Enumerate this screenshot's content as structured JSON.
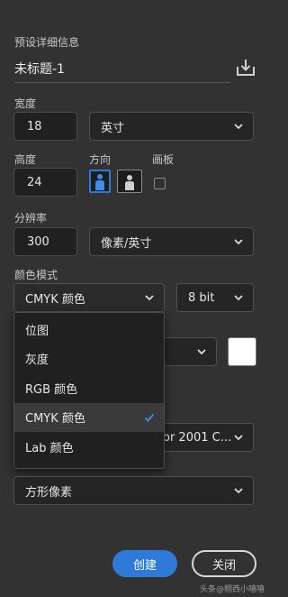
{
  "panel": {
    "title": "预设详细信息",
    "doc_name": "未标题-1",
    "width": {
      "label": "宽度",
      "value": "18",
      "unit": "英寸"
    },
    "height": {
      "label": "高度",
      "value": "24"
    },
    "orientation": {
      "label": "方向"
    },
    "artboard": {
      "label": "画板"
    },
    "resolution": {
      "label": "分辨率",
      "value": "300",
      "unit": "像素/英寸"
    },
    "color_mode": {
      "label": "颜色模式",
      "value": "CMYK 颜色",
      "bit_depth": "8 bit",
      "options": [
        "位图",
        "灰度",
        "RGB 颜色",
        "CMYK 颜色",
        "Lab 颜色"
      ],
      "selected_index": 3
    },
    "color_profile_partial": "or 2001 C...",
    "pixel_aspect": "方形像素"
  },
  "buttons": {
    "create": "创建",
    "close": "关闭"
  },
  "watermark": "头条@桐西小嘻嘻",
  "colors": {
    "accent": "#2f7ad9",
    "background": "#323232"
  }
}
